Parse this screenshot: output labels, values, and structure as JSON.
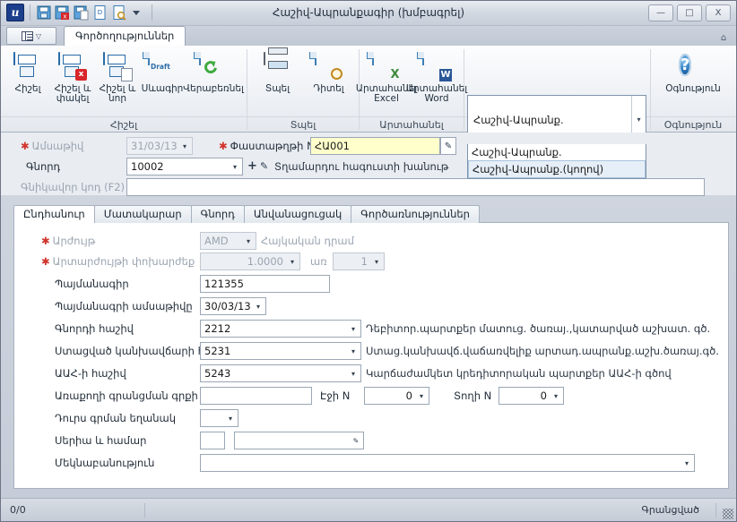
{
  "window": {
    "title": "Հաշիվ-Ապրանքագիր (խմբագրել)",
    "app_icon": "u",
    "minimize": "—",
    "maximize": "□",
    "close": "X"
  },
  "quick_access": [
    {
      "name": "save-icon"
    },
    {
      "name": "save-and-close-icon"
    },
    {
      "name": "save-and-new-icon"
    },
    {
      "name": "draft-icon"
    },
    {
      "name": "preview-icon"
    },
    {
      "name": "customize-qat-icon"
    }
  ],
  "ribbon": {
    "app_menu_label": "",
    "tabs": [
      {
        "label": "Գործողություններ",
        "active": true
      }
    ],
    "collapse_icon": "⌂",
    "groups": [
      {
        "label": "Հիշել",
        "buttons": [
          {
            "label": "Հիշել",
            "icon": "save-icon"
          },
          {
            "label": "Հիշել և\nփակել",
            "label_l1": "Հիշել և",
            "label_l2": "փակել",
            "icon": "save-and-close-icon"
          },
          {
            "label": "Հիշել և\nնոր",
            "label_l1": "Հիշել և",
            "label_l2": "նոր",
            "icon": "save-and-new-icon"
          },
          {
            "label": "Սևագիր",
            "icon": "draft-icon"
          },
          {
            "label": "Վերաբեռնել",
            "icon": "reload-icon"
          }
        ]
      },
      {
        "label": "Տպել",
        "buttons": [
          {
            "label": "Տպել",
            "icon": "printer-icon"
          },
          {
            "label": "Դիտել",
            "icon": "print-preview-icon"
          }
        ]
      },
      {
        "label": "Արտահանել",
        "buttons": [
          {
            "label_l1": "Արտահանել",
            "label_l2": "Excel",
            "icon": "export-excel-icon"
          },
          {
            "label_l1": "Արտահանել",
            "label_l2": "Word",
            "icon": "export-word-icon"
          }
        ]
      },
      {
        "label": "Օգնություն",
        "buttons": [
          {
            "label": "Օգնություն",
            "icon": "help-icon"
          }
        ]
      }
    ],
    "doctype": {
      "value": "Հաշիվ-Ապրանք.",
      "options": [
        {
          "label": "Հաշիվ-Ապրանք.",
          "selected": false
        },
        {
          "label": "Հաշիվ-Ապրանք.(կողով)",
          "selected": true
        }
      ],
      "arrow": "▾"
    }
  },
  "header_form": {
    "date": {
      "label": "Ամսաթիվ",
      "required": true,
      "value": "31/03/13",
      "arrow": "▾"
    },
    "doc_number": {
      "label": "Փաստաթղթի N",
      "required": true,
      "value": "ՀԱ001",
      "wand_icon": "wand-icon"
    },
    "customer": {
      "label": "Գնորդ",
      "value": "10002",
      "arrow": "▾",
      "plus": "+",
      "pencil": "✎",
      "side_text": "Տղամարդու հագուստի խանութ"
    },
    "price_type": {
      "label": "Գնիկավոր կոդ (F2)",
      "value": ""
    }
  },
  "tabs": [
    {
      "label": "Ընդհանուր",
      "active": true
    },
    {
      "label": "Մատակարար",
      "active": false
    },
    {
      "label": "Գնորդ",
      "active": false
    },
    {
      "label": "Անվանացուցակ",
      "active": false
    },
    {
      "label": "Գործառնություններ",
      "active": false
    }
  ],
  "fields": {
    "currency": {
      "label": "Արժույթ",
      "required": true,
      "value": "AMD",
      "arrow": "▾",
      "side_text": "Հայկական դրամ"
    },
    "exchange_rate": {
      "label": "Արտարժույթի փոխարժեք",
      "required": true,
      "value": "1.0000",
      "arrow": "▾",
      "per_label": "առ",
      "per_value": "1",
      "per_arrow": "▾"
    },
    "contract": {
      "label": "Պայմանագիր",
      "value": "121355"
    },
    "contract_date": {
      "label": "Պայմանագրի ամսաթիվը",
      "value": "30/03/13",
      "arrow": "▾"
    },
    "customer_account": {
      "label": "Գնորդի հաշիվ",
      "value": "2212",
      "arrow": "▾",
      "side_text": "Դեբիտոր.պարտքեր մատուց. ծառայ.,կատարված աշխատ. գծ."
    },
    "prepay_account": {
      "label": "Ստացված կանխավճարի հաշիվ",
      "value": "5231",
      "arrow": "▾",
      "side_text": "Ստաց.կանխավճ.վաճառվելիք արտադ.ապրանք.աշխ.ծառայ.գծ."
    },
    "vat_account": {
      "label": "ԱԱՀ-ի հաշիվ",
      "value": "5243",
      "arrow": "▾",
      "side_text": "Կարճաժամկետ կրեդիտորական պարտքեր ԱԱՀ-ի գծով"
    },
    "delivery_note": {
      "label": "Առաքողի գրանցման գրքի N",
      "value": "",
      "page_label": "Էջի N",
      "page_value": "0",
      "page_arrow": "▾",
      "line_label": "Տողի N",
      "line_value": "0",
      "line_arrow": "▾"
    },
    "external_form": {
      "label": "Դուրս գրման եղանակ",
      "value": "",
      "arrow": "▾"
    },
    "series_number": {
      "label": "Սերիա և համար",
      "series_value": "",
      "number_value": "",
      "wand_icon": "wand-icon"
    },
    "comment": {
      "label": "Մեկնաբանություն",
      "value": "",
      "arrow": "▾"
    }
  },
  "statusbar": {
    "record_counter": "0/0",
    "state": "Գրանցված",
    "grip_icon": "resize-grip-icon"
  }
}
